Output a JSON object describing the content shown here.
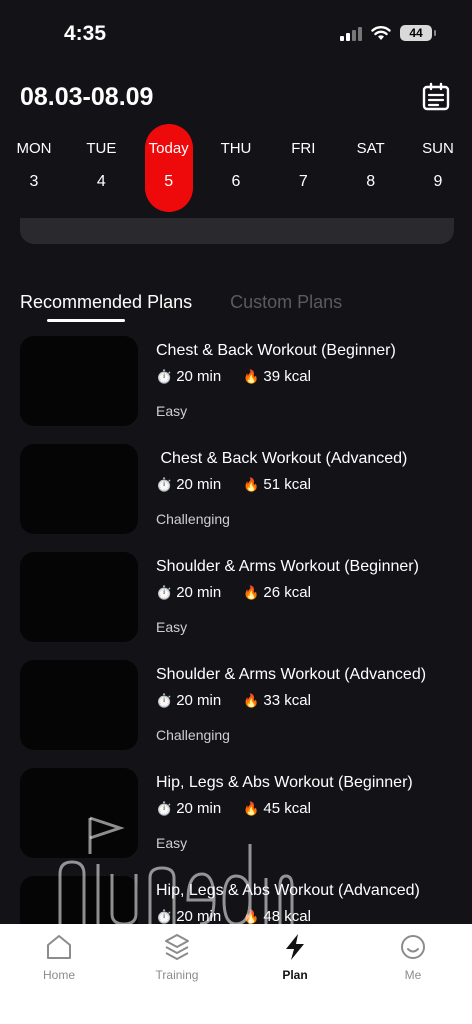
{
  "status": {
    "time": "4:35",
    "battery": "44"
  },
  "header": {
    "week_range": "08.03-08.09"
  },
  "week": [
    {
      "name": "MON",
      "num": "3"
    },
    {
      "name": "TUE",
      "num": "4"
    },
    {
      "name": "Today",
      "num": "5"
    },
    {
      "name": "THU",
      "num": "6"
    },
    {
      "name": "FRI",
      "num": "7"
    },
    {
      "name": "SAT",
      "num": "8"
    },
    {
      "name": "SUN",
      "num": "9"
    }
  ],
  "tabs": {
    "recommended": "Recommended Plans",
    "custom": "Custom Plans"
  },
  "plans": [
    {
      "title": "Chest & Back Workout (Beginner)",
      "duration": "20 min",
      "kcal": "39 kcal",
      "level": "Easy"
    },
    {
      "title": " Chest & Back Workout (Advanced)",
      "duration": "20 min",
      "kcal": "51 kcal",
      "level": "Challenging"
    },
    {
      "title": "Shoulder & Arms Workout (Beginner)",
      "duration": "20 min",
      "kcal": "26 kcal",
      "level": "Easy"
    },
    {
      "title": "Shoulder & Arms Workout (Advanced)",
      "duration": "20 min",
      "kcal": "33 kcal",
      "level": "Challenging"
    },
    {
      "title": "Hip, Legs & Abs Workout (Beginner)",
      "duration": "20 min",
      "kcal": "45 kcal",
      "level": "Easy"
    },
    {
      "title": "Hip, Legs & Abs Workout (Advanced)",
      "duration": "20 min",
      "kcal": "48 kcal",
      "level": ""
    }
  ],
  "nav": {
    "home": "Home",
    "training": "Training",
    "plan": "Plan",
    "me": "Me"
  },
  "colors": {
    "accent": "#ee0a0b",
    "background": "#131217",
    "panel": "#2a292e"
  },
  "icons": {
    "stopwatch": "stopwatch-icon",
    "fire": "fire-icon",
    "calendar": "calendar-list-icon"
  }
}
